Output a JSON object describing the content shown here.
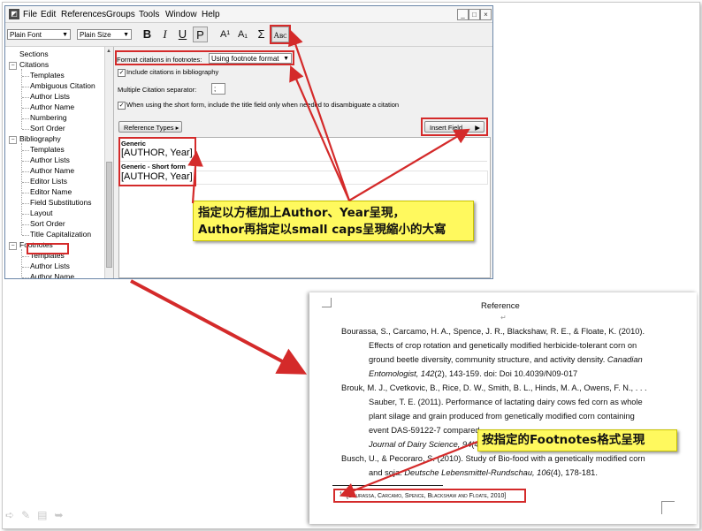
{
  "app": {
    "menu": [
      "File",
      "Edit",
      "References",
      "Groups",
      "Tools",
      "Window",
      "Help"
    ],
    "window_buttons": [
      "_",
      "□",
      "×"
    ],
    "toolbar": {
      "font_combo": "Plain Font",
      "size_combo": "Plain Size",
      "bold": "B",
      "italic": "I",
      "underline": "U",
      "plain": "P",
      "superscript": "A¹",
      "subscript": "A₁",
      "symbol": "Σ",
      "small_caps": "Aʙᴄ"
    },
    "tree": {
      "items": [
        {
          "label": "Sections",
          "level": 0,
          "expander": ""
        },
        {
          "label": "Citations",
          "level": 0,
          "expander": "−"
        },
        {
          "label": "Templates",
          "level": 1
        },
        {
          "label": "Ambiguous Citation",
          "level": 1
        },
        {
          "label": "Author Lists",
          "level": 1
        },
        {
          "label": "Author Name",
          "level": 1
        },
        {
          "label": "Numbering",
          "level": 1
        },
        {
          "label": "Sort Order",
          "level": 1
        },
        {
          "label": "Bibliography",
          "level": 0,
          "expander": "−"
        },
        {
          "label": "Templates",
          "level": 1
        },
        {
          "label": "Author Lists",
          "level": 1
        },
        {
          "label": "Author Name",
          "level": 1
        },
        {
          "label": "Editor Lists",
          "level": 1
        },
        {
          "label": "Editor Name",
          "level": 1
        },
        {
          "label": "Field Substitutions",
          "level": 1
        },
        {
          "label": "Layout",
          "level": 1
        },
        {
          "label": "Sort Order",
          "level": 1
        },
        {
          "label": "Title Capitalization",
          "level": 1
        },
        {
          "label": "Footnotes",
          "level": 0,
          "expander": "−"
        },
        {
          "label": "Templates",
          "level": 1
        },
        {
          "label": "Author Lists",
          "level": 1
        },
        {
          "label": "Author Name",
          "level": 1
        }
      ]
    },
    "panel": {
      "format_label": "Format citations in footnotes:",
      "format_value": "Using footnote format",
      "include_label": "Include citations in bibliography",
      "separator_label": "Multiple Citation separator:",
      "separator_value": ";",
      "short_form_label": "When using the short form, include the title field only when needed to disambiguate a citation",
      "reference_types_button": "Reference Types ▸",
      "insert_field_button": "Insert Field",
      "generic_heading": "Generic",
      "generic_template": "[AUTHOR, Year]",
      "short_heading": "Generic - Short form",
      "short_template": "[AUTHOR, Year]"
    }
  },
  "callout_top": {
    "line1": "指定以方框加上Author、Year呈現，",
    "line2": "Author再指定以small caps呈現縮小的大寫"
  },
  "callout_bottom": "按指定的Footnotes格式呈現",
  "document": {
    "heading": "Reference",
    "lines": [
      {
        "text": "Bourassa, S., Carcamo, H. A., Spence, J. R., Blackshaw, R. E., & Floate, K. (2010).",
        "indent": false
      },
      {
        "text": "Effects of crop rotation and genetically modified herbicide-tolerant corn on",
        "indent": true
      },
      {
        "text": "ground beetle diversity, community structure, and activity density.",
        "italic_tail": " Canadian",
        "indent": true
      },
      {
        "italic_head": "Entomologist, 142",
        "text": "(2), 143-159.  doi: Doi 10.4039/N09-017",
        "indent": true
      },
      {
        "text": "Brouk, M. J., Cvetkovic, B., Rice, D. W., Smith, B. L., Hinds, M. A., Owens, F. N., . . .",
        "indent": false
      },
      {
        "text": "Sauber, T. E. (2011). Performance of lactating dairy cows fed corn as whole",
        "indent": true
      },
      {
        "text": "plant silage and grain produced from genetically modified corn containing",
        "indent": true
      },
      {
        "text": "event DAS-59122-7 compared",
        "indent": true
      },
      {
        "italic_head": "Journal of Dairy Science, 94",
        "text": "(4",
        "indent": true
      },
      {
        "text": "Busch, U., & Pecoraro, S. (2010). Study of Bio-food with a genetically modified corn",
        "indent": false
      },
      {
        "text": "and soja.",
        "italic_tail": " Deutsche Lebensmittel-Rundschau, 106",
        "tail_after": "(4), 178-181.",
        "indent": true
      }
    ],
    "footnote_number": "1",
    "footnote": "[Bourassa, Carcamo, Spence, Blackshaw and Floate, 2010]"
  },
  "colors": {
    "highlight_red": "#d42a2a",
    "callout_yellow": "#fff95e"
  }
}
